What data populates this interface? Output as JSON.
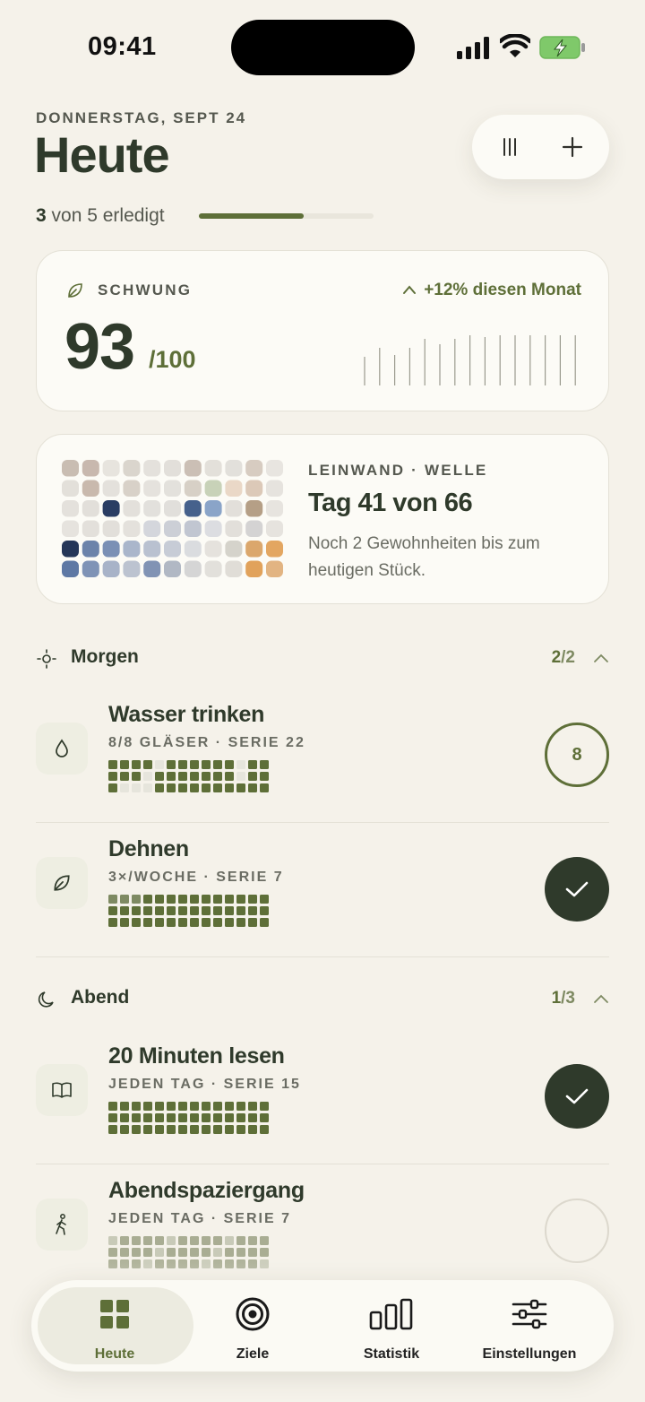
{
  "status": {
    "time": "09:41"
  },
  "header": {
    "date": "DONNERSTAG, SEPT 24",
    "title": "Heute",
    "done_count": "3",
    "progress_text": " von 5 erledigt",
    "progress_fraction": 0.6
  },
  "momentum": {
    "label": "SCHWUNG",
    "trend": "+12% diesen Monat",
    "score": "93",
    "score_of": "/100"
  },
  "canvas": {
    "label": "LEINWAND · WELLE",
    "title": "Tag 41 von 66",
    "subtitle": "Noch 2 Gewohnheiten bis zum heutigen Stück."
  },
  "sections": {
    "morning": {
      "title": "Morgen",
      "done": "2",
      "total": "/2"
    },
    "evening": {
      "title": "Abend",
      "done": "1",
      "total": "/3"
    }
  },
  "habits": [
    {
      "name": "Wasser trinken",
      "meta": "8/8 GLÄSER · SERIE 22",
      "icon": "water-drop-icon",
      "status": "count",
      "count": "8"
    },
    {
      "name": "Dehnen",
      "meta": "3×/WOCHE · SERIE 7",
      "icon": "leaf-icon",
      "status": "done"
    },
    {
      "name": "20 Minuten lesen",
      "meta": "JEDEN TAG · SERIE 15",
      "icon": "book-icon",
      "status": "done"
    },
    {
      "name": "Abendspaziergang",
      "meta": "JEDEN TAG · SERIE 7",
      "icon": "walking-icon",
      "status": "open"
    }
  ],
  "nav": [
    {
      "label": "Heute",
      "icon": "grid-icon",
      "active": true
    },
    {
      "label": "Ziele",
      "icon": "target-icon",
      "active": false
    },
    {
      "label": "Statistik",
      "icon": "bar-chart-icon",
      "active": false
    },
    {
      "label": "Einstellungen",
      "icon": "sliders-icon",
      "active": false
    }
  ],
  "colors": {
    "accent": "#5e6f38",
    "dark": "#2f3a2b",
    "background": "#f5f2ea",
    "card": "#fcfbf6"
  }
}
